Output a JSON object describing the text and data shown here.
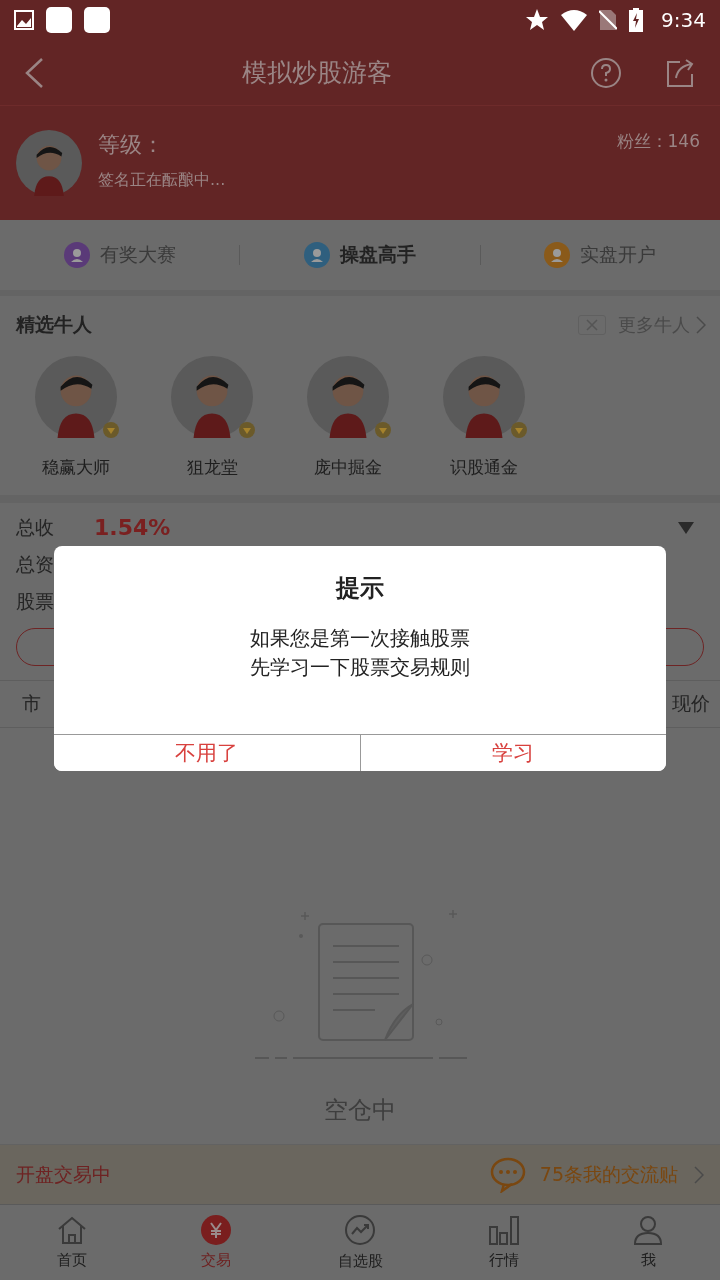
{
  "status_bar": {
    "time": "9:34"
  },
  "header": {
    "title": "模拟炒股游客"
  },
  "profile": {
    "level_label": "等级：",
    "signature": "签名正在酝酿中...",
    "fans": "粉丝：146"
  },
  "shortcuts": [
    {
      "label": "有奖大赛",
      "color": "#5a3a78",
      "selected": false
    },
    {
      "label": "操盘高手",
      "color": "#2f5f7e",
      "selected": true
    },
    {
      "label": "实盘开户",
      "color": "#8a5a1a",
      "selected": false
    }
  ],
  "featured": {
    "title": "精选牛人",
    "more": "更多牛人",
    "people": [
      {
        "name": "稳赢大师"
      },
      {
        "name": "狙龙堂"
      },
      {
        "name": "庞中掘金"
      },
      {
        "name": "识股通金"
      }
    ]
  },
  "summary": {
    "rows": [
      {
        "label": "总收",
        "value": "1.54%"
      },
      {
        "label": "总资"
      },
      {
        "label": "股票"
      }
    ]
  },
  "table": {
    "columns": [
      "市",
      "现价"
    ]
  },
  "empty_state": {
    "text": "空仓中"
  },
  "notice": {
    "status": "开盘交易中",
    "posts": "75条我的交流贴"
  },
  "tabs": [
    {
      "label": "首页",
      "selected": false
    },
    {
      "label": "交易",
      "selected": true
    },
    {
      "label": "自选股",
      "selected": false
    },
    {
      "label": "行情",
      "selected": false
    },
    {
      "label": "我",
      "selected": false
    }
  ],
  "dialog": {
    "title": "提示",
    "message_lines": [
      "如果您是第一次接触股票",
      "先学习一下股票交易规则"
    ],
    "buttons": [
      "不用了",
      "学习"
    ]
  }
}
